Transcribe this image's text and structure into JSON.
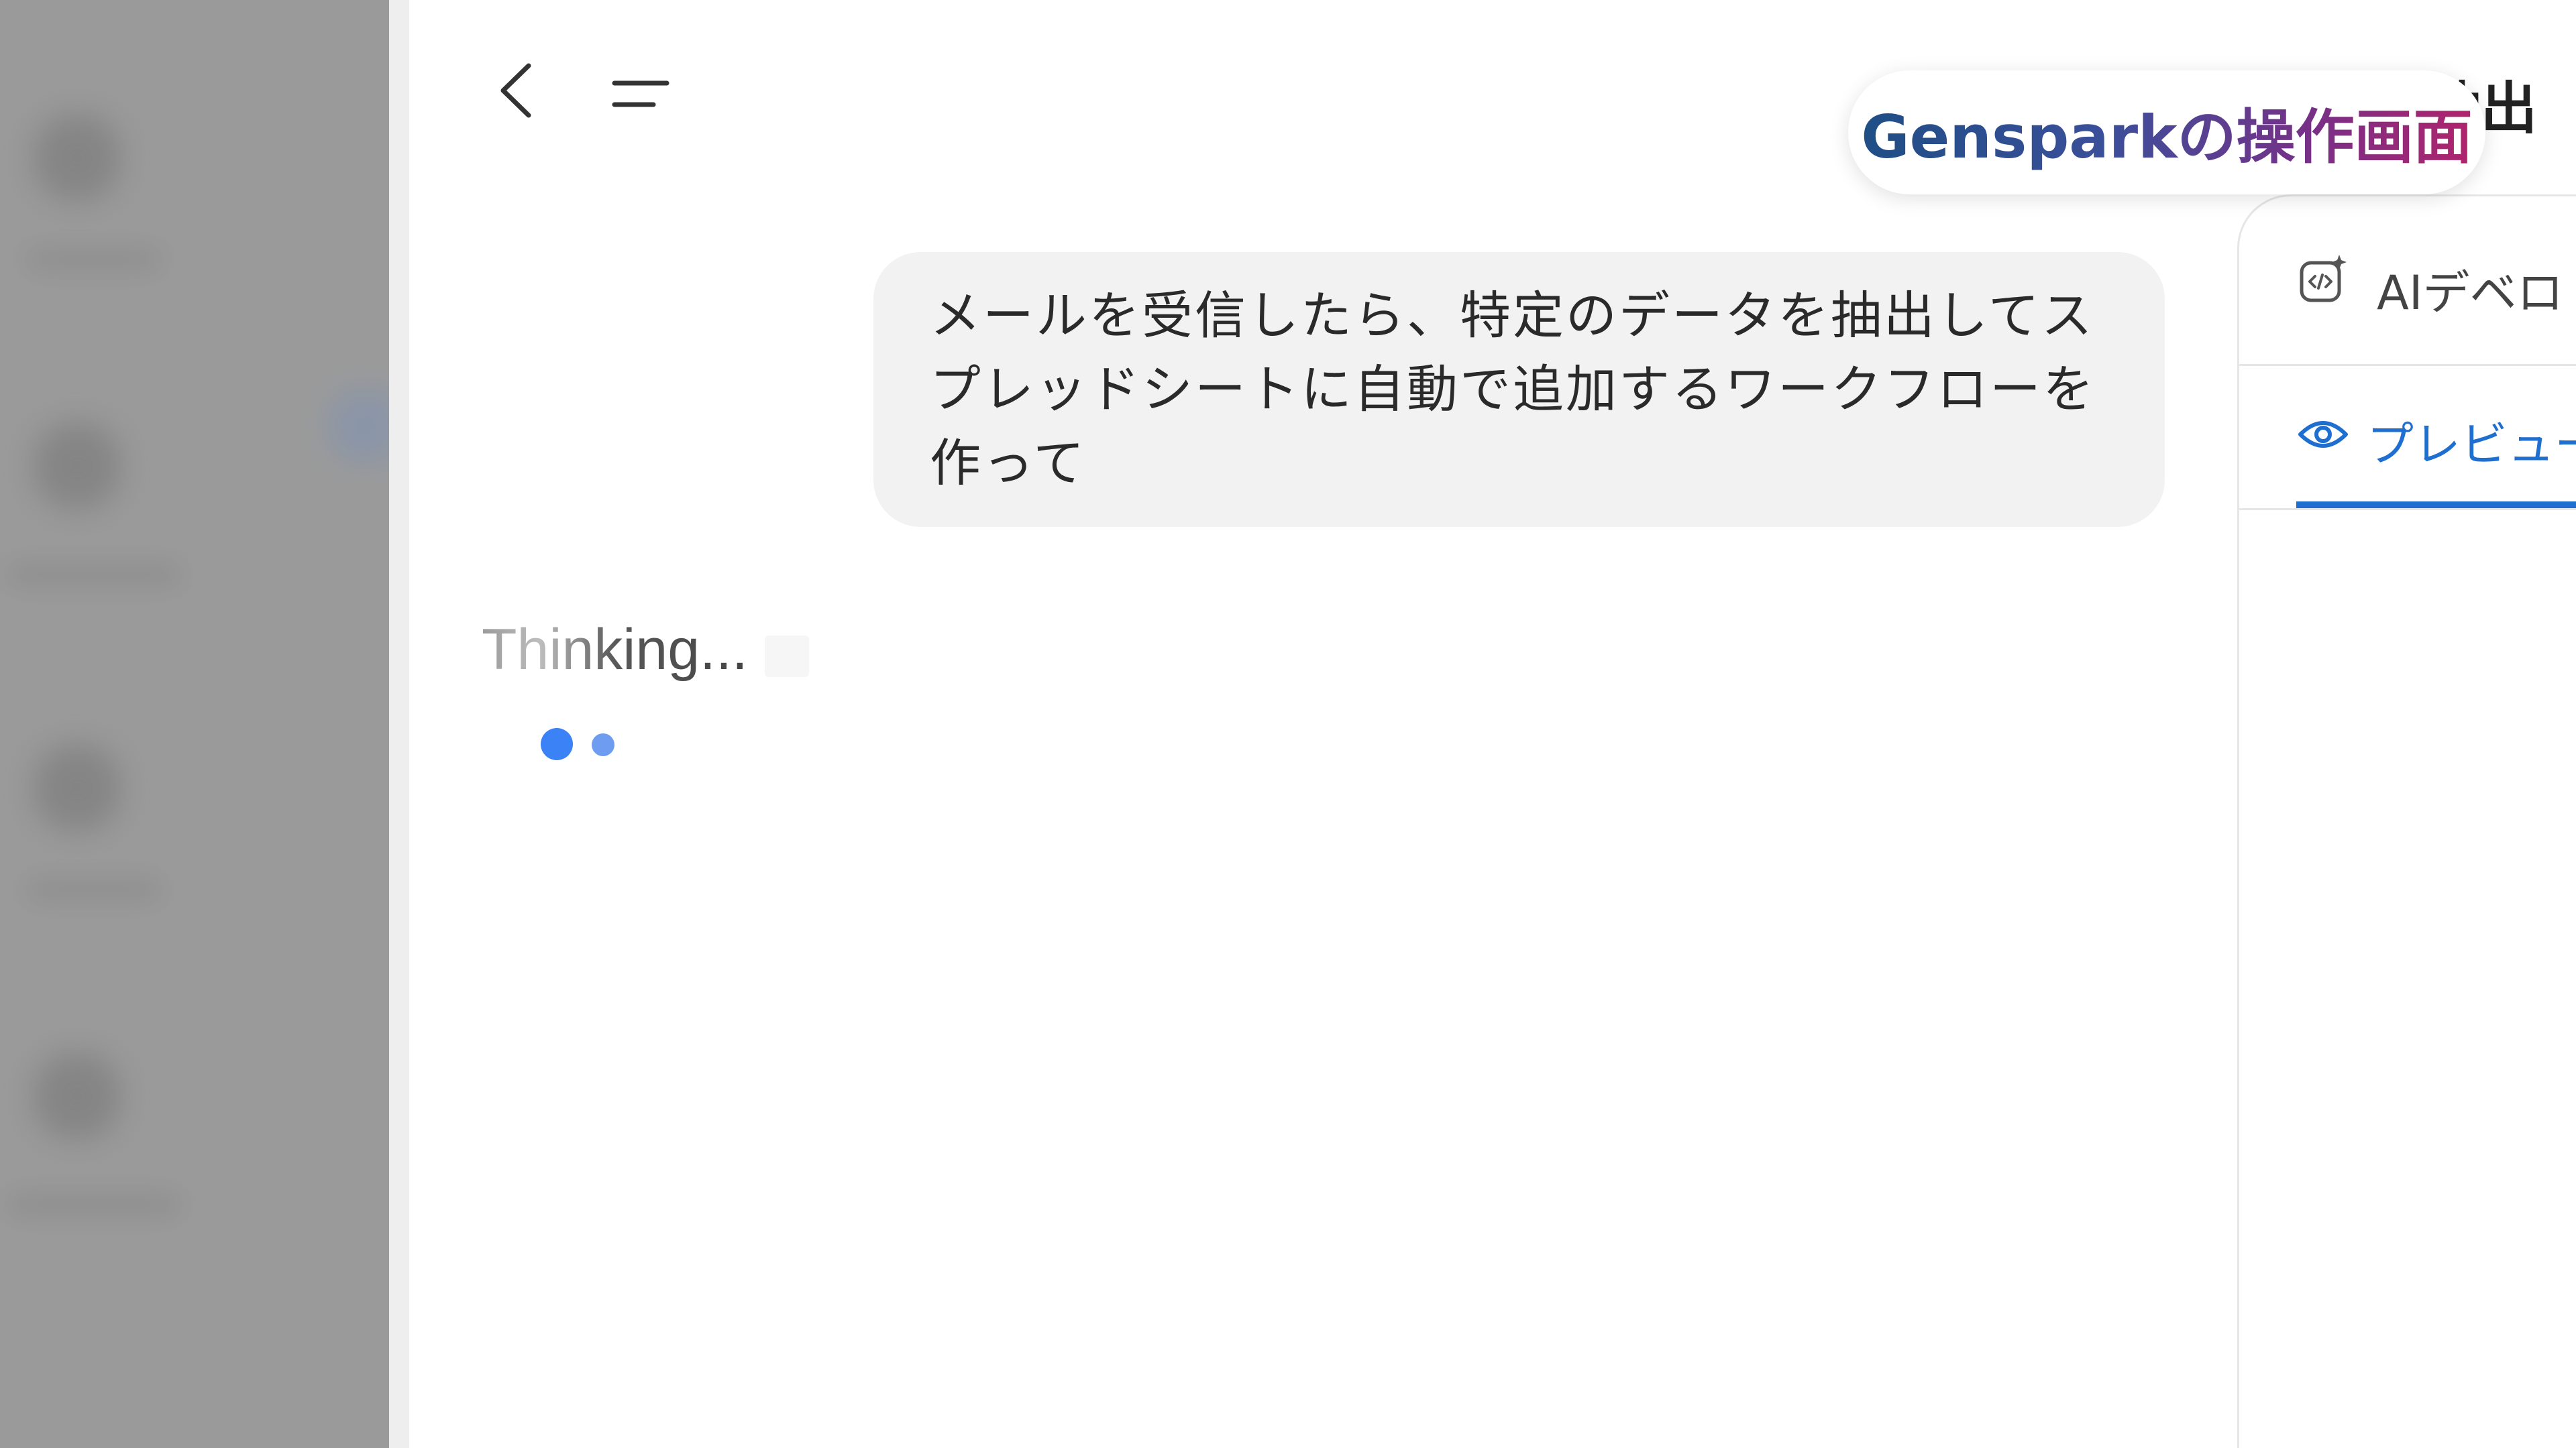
{
  "header": {
    "title_partial": "を抽出"
  },
  "overlay_badge": {
    "label": "Gensparkの操作画面"
  },
  "chat": {
    "user_message": "メールを受信したら、特定のデータを抽出してスプレッドシートに自動で追加するワークフローを作って",
    "status": "Thinking..."
  },
  "right_panel": {
    "agent_label": "AIデベロ",
    "tab_label": "プレビュー"
  },
  "icons": {
    "back": "chevron-left-icon",
    "menu": "menu-icon",
    "ai_developer": "code-sparkle-icon",
    "preview": "eye-icon"
  },
  "colors": {
    "accent_blue": "#1f6fd1",
    "dot_blue": "#3b82f6",
    "bubble_bg": "#f2f2f2",
    "sidebar_bg": "#9a9a9a"
  }
}
